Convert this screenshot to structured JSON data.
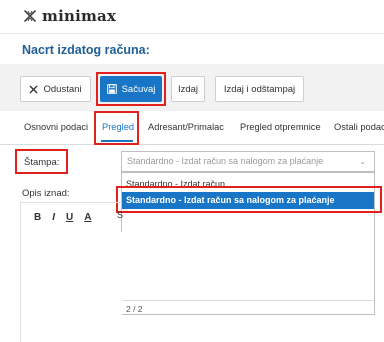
{
  "app": {
    "logo_text": "minimax"
  },
  "page": {
    "title": "Nacrt izdatog računa:"
  },
  "toolbar": {
    "cancel_label": "Odustani",
    "save_label": "Sačuvaj",
    "issue_label": "Izdaj",
    "issue_print_label": "Izdaj i odštampaj"
  },
  "tabs": [
    {
      "label": "Osnovni podaci"
    },
    {
      "label": "Pregled"
    },
    {
      "label": "Adresant/Primalac"
    },
    {
      "label": "Pregled otpremnice"
    },
    {
      "label": "Ostali podaci"
    }
  ],
  "form": {
    "stampa_label": "Štampa:",
    "stampa_value": "Standardno - Izdat račun sa nalogom za plaćanje",
    "opis_label": "Opis iznad:"
  },
  "dropdown": {
    "options": [
      {
        "label": "Standardno - Izdat račun"
      },
      {
        "label": "Standardno - Izdat račun sa nalogom za plaćanje"
      }
    ],
    "footer": "2 / 2"
  },
  "editor": {
    "bold": "B",
    "italic": "I",
    "underline": "U",
    "font_color": "A",
    "partial": "S"
  },
  "colors": {
    "accent": "#1976c7",
    "highlight_box": "#e0211d",
    "title": "#1f5e96"
  }
}
